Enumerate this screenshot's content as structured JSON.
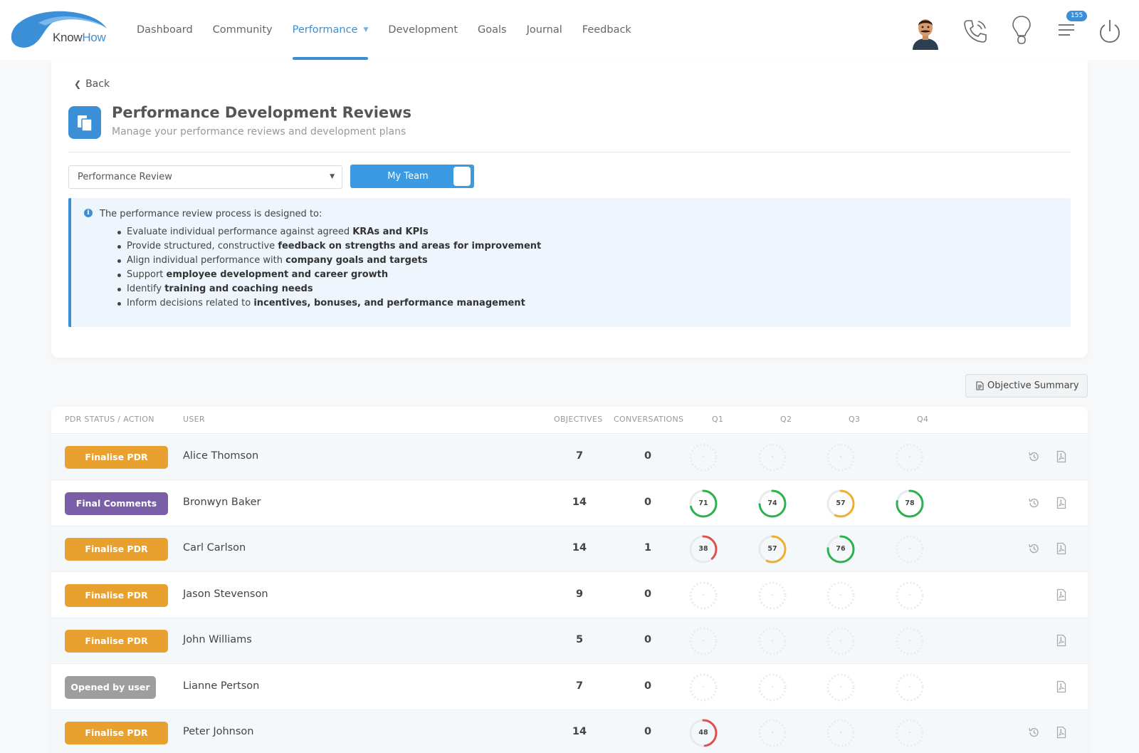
{
  "app": {
    "logo_prefix": "Know",
    "logo_suffix": "How",
    "notification_count": "155"
  },
  "nav": {
    "items": [
      {
        "label": "Dashboard",
        "active": false
      },
      {
        "label": "Community",
        "active": false
      },
      {
        "label": "Performance",
        "active": true,
        "has_dropdown": true
      },
      {
        "label": "Development",
        "active": false
      },
      {
        "label": "Goals",
        "active": false
      },
      {
        "label": "Journal",
        "active": false
      },
      {
        "label": "Feedback",
        "active": false
      }
    ]
  },
  "header": {
    "back_label": "Back",
    "title": "Performance Development Reviews",
    "subtitle": "Manage your performance reviews and development plans"
  },
  "filters": {
    "review_type": "Performance Review",
    "team_toggle_label": "My Team"
  },
  "info": {
    "intro": "The performance review process is designed to:",
    "points": [
      {
        "text": "Evaluate individual performance against agreed ",
        "bold": "KRAs and KPIs"
      },
      {
        "text": "Provide structured, constructive ",
        "bold": "feedback on strengths and areas for improvement"
      },
      {
        "text": "Align individual performance with ",
        "bold": "company goals and targets"
      },
      {
        "text": "Support ",
        "bold": "employee development and career growth"
      },
      {
        "text": "Identify ",
        "bold": "training and coaching needs"
      },
      {
        "text": "Inform decisions related to ",
        "bold": "incentives, bonuses, and performance management"
      }
    ]
  },
  "objective_summary_label": "Objective Summary",
  "table": {
    "headers": {
      "status": "PDR STATUS / ACTION",
      "user": "USER",
      "objectives": "OBJECTIVES",
      "conversations": "CONVERSATIONS",
      "q1": "Q1",
      "q2": "Q2",
      "q3": "Q3",
      "q4": "Q4"
    },
    "empty_score": "-",
    "rows": [
      {
        "status": "Finalise PDR",
        "status_kind": "finalise",
        "user": "Alice Thomson",
        "objectives": "7",
        "conversations": "0",
        "scores": [
          null,
          null,
          null,
          null
        ],
        "history": true
      },
      {
        "status": "Final Comments",
        "status_kind": "final-comments",
        "user": "Bronwyn Baker",
        "objectives": "14",
        "conversations": "0",
        "scores": [
          71,
          74,
          57,
          78
        ],
        "history": true
      },
      {
        "status": "Finalise PDR",
        "status_kind": "finalise",
        "user": "Carl Carlson",
        "objectives": "14",
        "conversations": "1",
        "scores": [
          38,
          57,
          76,
          null
        ],
        "history": true
      },
      {
        "status": "Finalise PDR",
        "status_kind": "finalise",
        "user": "Jason Stevenson",
        "objectives": "9",
        "conversations": "0",
        "scores": [
          null,
          null,
          null,
          null
        ],
        "history": false
      },
      {
        "status": "Finalise PDR",
        "status_kind": "finalise",
        "user": "John Williams",
        "objectives": "5",
        "conversations": "0",
        "scores": [
          null,
          null,
          null,
          null
        ],
        "history": false
      },
      {
        "status": "Opened by user",
        "status_kind": "opened",
        "user": "Lianne Pertson",
        "objectives": "7",
        "conversations": "0",
        "scores": [
          null,
          null,
          null,
          null
        ],
        "history": false
      },
      {
        "status": "Finalise PDR",
        "status_kind": "finalise",
        "user": "Peter Johnson",
        "objectives": "14",
        "conversations": "0",
        "scores": [
          48,
          null,
          null,
          null
        ],
        "history": true
      }
    ]
  },
  "colors": {
    "accent": "#3a8fd6",
    "finalise": "#e8a02e",
    "final_comments": "#7b5ea8",
    "opened": "#9e9e9e",
    "score_high": "#2bb24c",
    "score_mid": "#f0ad2e",
    "score_low": "#e0504d"
  },
  "icons": {
    "history": "history-icon",
    "pdf": "pdf-icon",
    "phone": "phone-icon",
    "bulb": "lightbulb-icon",
    "menu": "menu-icon",
    "power": "power-icon"
  }
}
